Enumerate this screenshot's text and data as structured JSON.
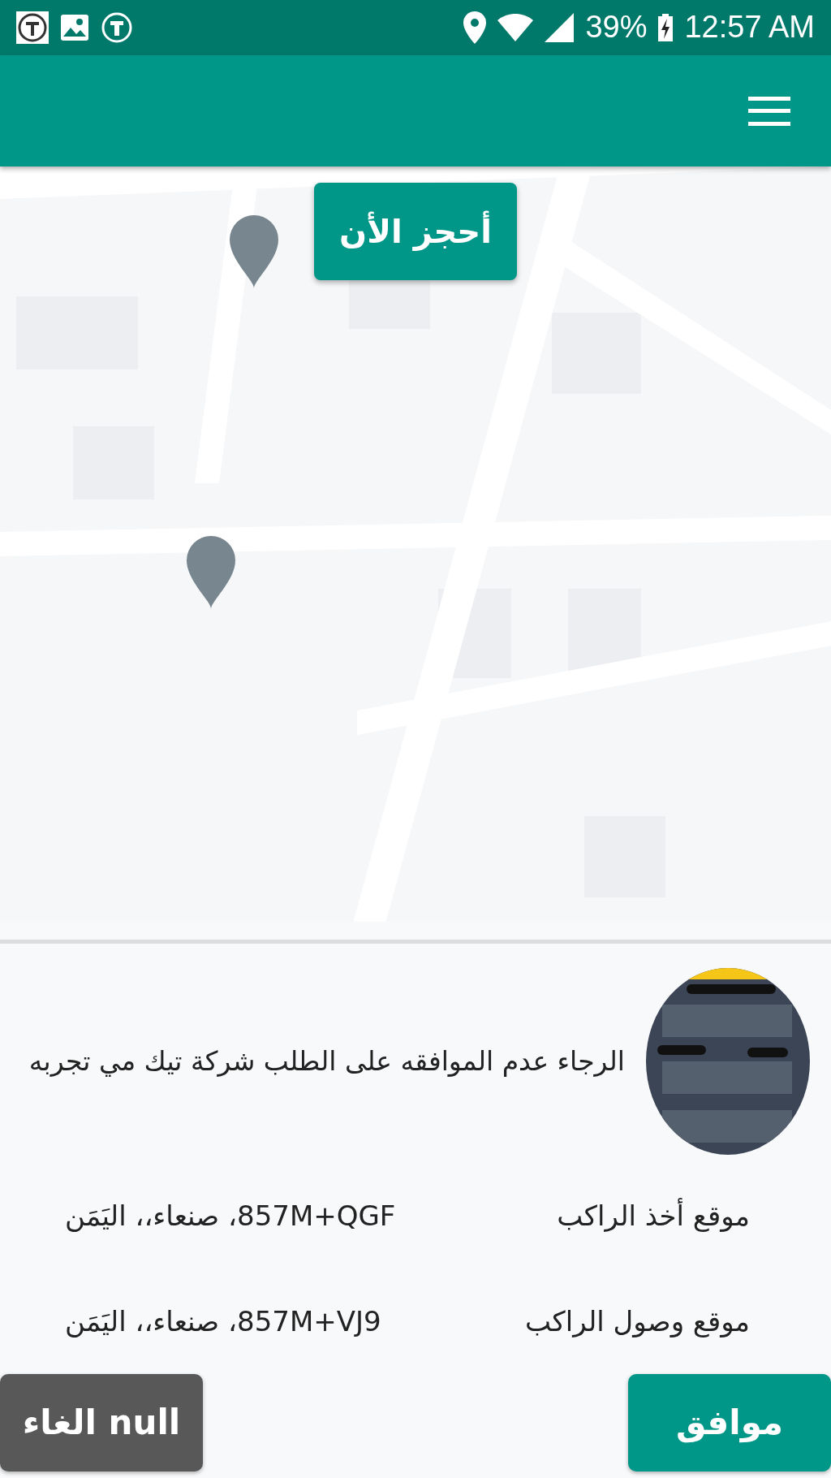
{
  "status_bar": {
    "battery": "39%",
    "time": "12:57 AM"
  },
  "map": {
    "book_button": "أحجز الأن"
  },
  "request": {
    "message": "الرجاء عدم الموافقه على الطلب شركة تيك مي تجربه"
  },
  "details": [
    {
      "label": "موقع أخذ الراكب",
      "value": "857M+QGF، صنعاء،، اليَمَن"
    },
    {
      "label": "موقع وصول الراكب",
      "value": "857M+VJ9، صنعاء،، اليَمَن"
    }
  ],
  "actions": {
    "cancel": "الغاء null",
    "confirm": "موافق"
  }
}
